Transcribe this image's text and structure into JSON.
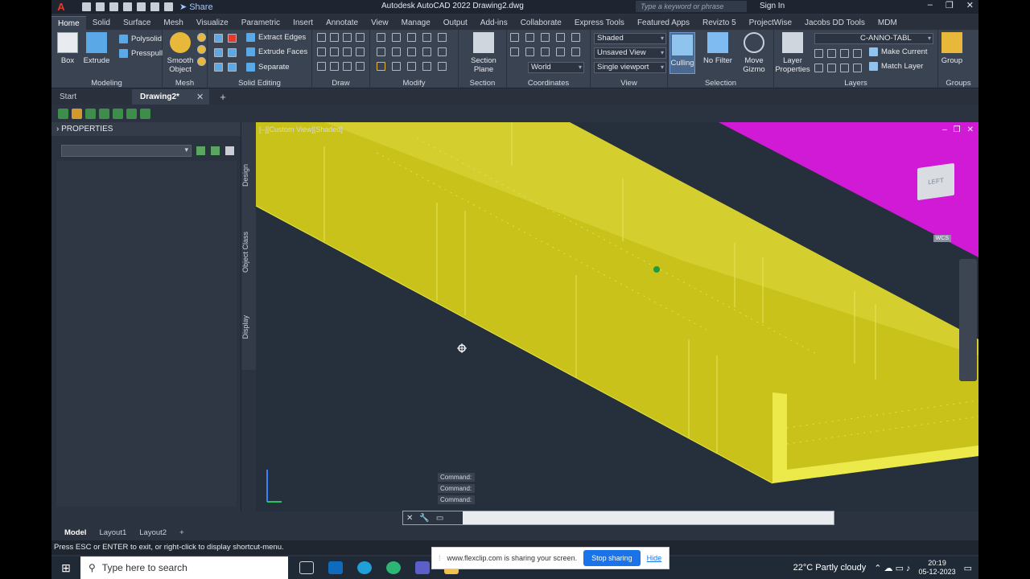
{
  "titlebar": {
    "app_logo": "A",
    "share": "Share",
    "title": "Autodesk AutoCAD 2022   Drawing2.dwg",
    "search_placeholder": "Type a keyword or phrase",
    "sign_in": "Sign In",
    "minimize": "–",
    "restore": "❐",
    "close": "✕"
  },
  "ribbon_tabs": [
    "Home",
    "Solid",
    "Surface",
    "Mesh",
    "Visualize",
    "Parametric",
    "Insert",
    "Annotate",
    "View",
    "Manage",
    "Output",
    "Add-ins",
    "Collaborate",
    "Express Tools",
    "Featured Apps",
    "Revizto 5",
    "ProjectWise",
    "Jacobs DD Tools",
    "MDM"
  ],
  "ribbon": {
    "modeling": {
      "title": "Modeling",
      "box": "Box",
      "extrude": "Extrude",
      "polysolid": "Polysolid",
      "presspull": "Presspull"
    },
    "mesh": {
      "title": "Mesh",
      "smooth": "Smooth Object"
    },
    "solid_editing": {
      "title": "Solid Editing",
      "extract_edges": "Extract Edges",
      "extrude_faces": "Extrude Faces",
      "separate": "Separate"
    },
    "draw": {
      "title": "Draw"
    },
    "modify": {
      "title": "Modify"
    },
    "section": {
      "title": "Section",
      "section_plane": "Section Plane"
    },
    "coordinates": {
      "title": "Coordinates",
      "world": "World"
    },
    "view": {
      "title": "View",
      "visual_style": "Shaded",
      "saved_view": "Unsaved View",
      "viewport": "Single viewport"
    },
    "selection": {
      "title": "Selection",
      "culling": "Culling",
      "no_filter": "No Filter",
      "move_gizmo": "Move Gizmo"
    },
    "layers": {
      "title": "Layers",
      "layer_properties": "Layer Properties",
      "layer_name": "C-ANNO-TABL",
      "make_current": "Make Current",
      "match_layer": "Match Layer"
    },
    "groups": {
      "title": "Groups",
      "group": "Group"
    }
  },
  "file_tabs": [
    "Start",
    "Drawing2*"
  ],
  "properties": {
    "title": "PROPERTIES",
    "vtabs": [
      "Design",
      "Object Class",
      "Display"
    ]
  },
  "viewport": {
    "label": "[–][Custom View][Shaded]",
    "viewcube_face": "LEFT",
    "wcs": "WCS"
  },
  "command": {
    "history": [
      "Command:",
      "Command:",
      "Command:"
    ],
    "input_placeholder": ""
  },
  "layout_tabs": [
    "Model",
    "Layout1",
    "Layout2"
  ],
  "status_text": "Press ESC or ENTER to exit, or right-click to display shortcut-menu.",
  "taskbar": {
    "search_placeholder": "Type here to search",
    "share_msg": "www.flexclip.com is sharing your screen.",
    "stop_sharing": "Stop sharing",
    "hide": "Hide",
    "weather": "22°C  Partly cloudy",
    "time": "20:19",
    "date": "05-12-2023"
  },
  "colors": {
    "model_yellow": "#c8c21a",
    "model_face_light": "#d2cd2a",
    "model_edge": "#f0ee58",
    "magenta": "#d01ad6",
    "accent_blue": "#1a73e8"
  }
}
